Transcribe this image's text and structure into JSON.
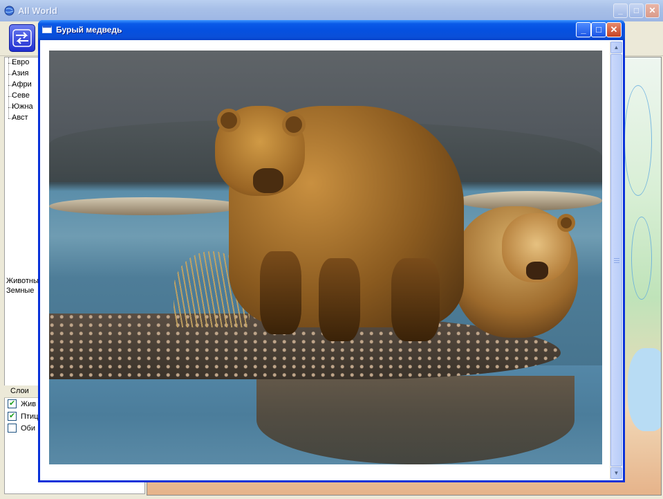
{
  "main_window": {
    "title": "All World",
    "title_buttons": [
      "minimize",
      "maximize",
      "close"
    ],
    "toolbar": {
      "nav_button_icon": "swap-arrows-icon"
    },
    "regions_tree": [
      "Евро",
      "Азия",
      "Афри",
      "Севе",
      "Южна",
      "Авст"
    ],
    "description_lines": [
      "Животны",
      "Земные"
    ],
    "layers": {
      "header": "Слои",
      "items": [
        {
          "label": "Жив",
          "checked": true
        },
        {
          "label": "Птиц",
          "checked": true
        },
        {
          "label": "Оби",
          "checked": false
        }
      ]
    }
  },
  "child_window": {
    "title": "Бурый медведь",
    "title_buttons": [
      "minimize",
      "maximize",
      "close"
    ],
    "image_subject": "brown-bear-with-cub-photo",
    "scrollbar": {
      "up": "▲",
      "down": "▼"
    }
  },
  "colors": {
    "xp_titlebar": "#0550e0",
    "inactive_titlebar": "#a8c0e8",
    "close_button": "#c74324",
    "window_face": "#ece9d8"
  }
}
